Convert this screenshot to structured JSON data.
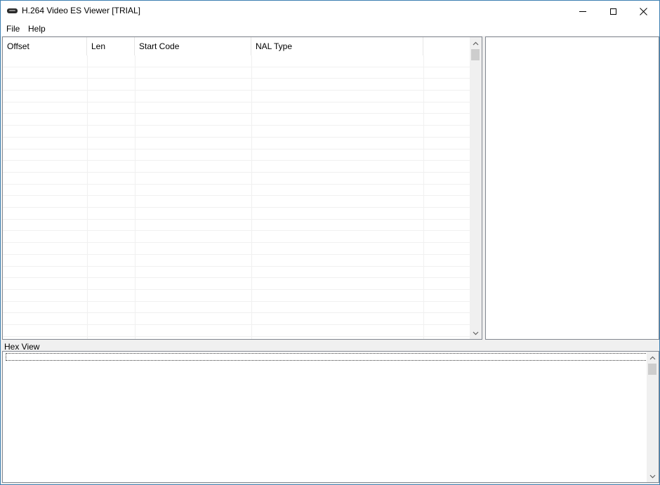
{
  "window": {
    "title": "H.264 Video ES Viewer [TRIAL]",
    "controls": {
      "minimize": "minimize-icon",
      "maximize": "maximize-icon",
      "close": "close-icon"
    }
  },
  "menu": {
    "file": "File",
    "help": "Help"
  },
  "list": {
    "columns": [
      "Offset",
      "Len",
      "Start Code",
      "NAL Type",
      ""
    ],
    "scroll_up_icon": "chevron-up-icon",
    "scroll_down_icon": "chevron-down-icon"
  },
  "hex_view": {
    "label": "Hex View"
  }
}
